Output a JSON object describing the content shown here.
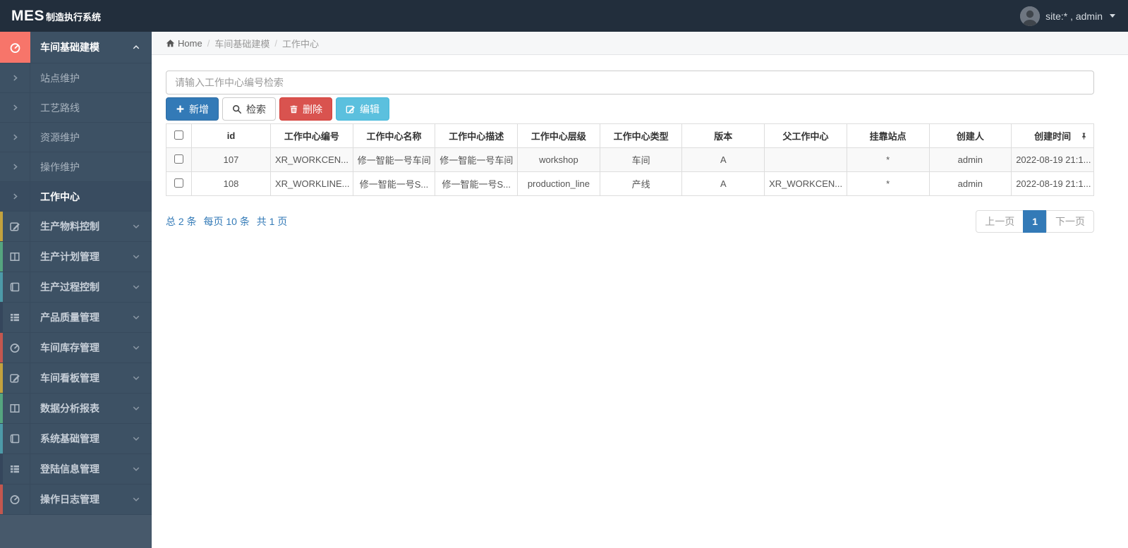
{
  "navbar": {
    "brand_bold": "MES",
    "brand_rest": "制造执行系统",
    "user_label": "site:* , admin"
  },
  "breadcrumb": {
    "home": "Home",
    "level1": "车间基础建模",
    "level2": "工作中心"
  },
  "sidebar": {
    "items": [
      {
        "label": "车间基础建模",
        "icon": "tachometer-icon"
      },
      {
        "label": "站点维护",
        "icon": "chevron-right-icon"
      },
      {
        "label": "工艺路线",
        "icon": "chevron-right-icon"
      },
      {
        "label": "资源维护",
        "icon": "chevron-right-icon"
      },
      {
        "label": "操作维护",
        "icon": "chevron-right-icon"
      },
      {
        "label": "工作中心",
        "icon": "chevron-right-icon"
      },
      {
        "label": "生产物料控制",
        "icon": "edit-icon"
      },
      {
        "label": "生产计划管理",
        "icon": "columns-icon"
      },
      {
        "label": "生产过程控制",
        "icon": "book-icon"
      },
      {
        "label": "产品质量管理",
        "icon": "list-icon"
      },
      {
        "label": "车间库存管理",
        "icon": "tachometer-icon"
      },
      {
        "label": "车间看板管理",
        "icon": "edit-icon"
      },
      {
        "label": "数据分析报表",
        "icon": "columns-icon"
      },
      {
        "label": "系统基础管理",
        "icon": "book-icon"
      },
      {
        "label": "登陆信息管理",
        "icon": "list-icon"
      },
      {
        "label": "操作日志管理",
        "icon": "tachometer-icon"
      }
    ]
  },
  "toolbar": {
    "search_placeholder": "请输入工作中心编号检索",
    "add_label": "新增",
    "search_label": "检索",
    "delete_label": "删除",
    "edit_label": "编辑"
  },
  "table": {
    "headers": [
      "id",
      "工作中心编号",
      "工作中心名称",
      "工作中心描述",
      "工作中心层级",
      "工作中心类型",
      "版本",
      "父工作中心",
      "挂靠站点",
      "创建人",
      "创建时间"
    ],
    "rows": [
      [
        "107",
        "XR_WORKCEN...",
        "修一智能一号车间",
        "修一智能一号车间",
        "workshop",
        "车间",
        "A",
        "",
        "*",
        "admin",
        "2022-08-19 21:1..."
      ],
      [
        "108",
        "XR_WORKLINE...",
        "修一智能一号S...",
        "修一智能一号S...",
        "production_line",
        "产线",
        "A",
        "XR_WORKCEN...",
        "*",
        "admin",
        "2022-08-19 21:1..."
      ]
    ]
  },
  "pagination": {
    "summary_total": "总 2 条",
    "summary_per_page": "每页 10 条",
    "summary_pages": "共 1 页",
    "prev_label": "上一页",
    "current_page": "1",
    "next_label": "下一页"
  },
  "colors": {
    "primary": "#337ab7",
    "danger": "#d9534f",
    "info": "#5bc0de",
    "accent_salmon": "#f7756a",
    "navbar_bg": "#222e3c",
    "sidebar_bg": "#3d5164",
    "strip_yellow": "#c3a23e",
    "strip_green": "#55a57f",
    "strip_teal": "#4d9aa8",
    "strip_red": "#c4574f"
  }
}
